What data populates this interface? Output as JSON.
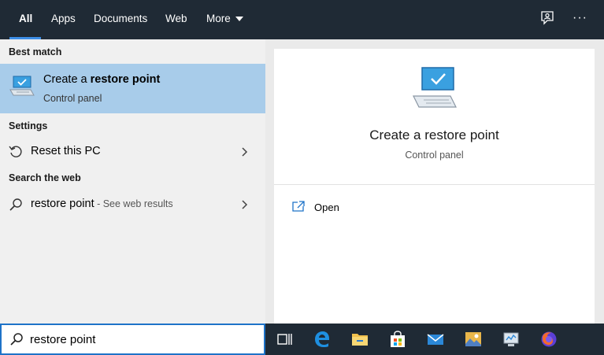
{
  "tabs": [
    "All",
    "Apps",
    "Documents",
    "Web",
    "More"
  ],
  "sections": {
    "best_match": "Best match",
    "settings": "Settings",
    "search_web": "Search the web"
  },
  "best_match": {
    "title_prefix": "Create a ",
    "title_bold": "restore point",
    "subtitle": "Control panel"
  },
  "settings_items": [
    {
      "label": "Reset this PC"
    }
  ],
  "web_item": {
    "query": "restore point",
    "hint": " - See web results"
  },
  "preview": {
    "title": "Create a restore point",
    "subtitle": "Control panel",
    "actions": [
      {
        "label": "Open"
      }
    ]
  },
  "search": {
    "value": "restore point"
  },
  "taskbar_icons": [
    "task-view-icon",
    "edge-icon",
    "file-explorer-icon",
    "store-icon",
    "mail-icon",
    "photos-icon",
    "control-panel-icon",
    "firefox-icon"
  ],
  "colors": {
    "accent": "#3d8ee6",
    "selection": "#a8ccea",
    "topbar": "#1f2a35"
  }
}
